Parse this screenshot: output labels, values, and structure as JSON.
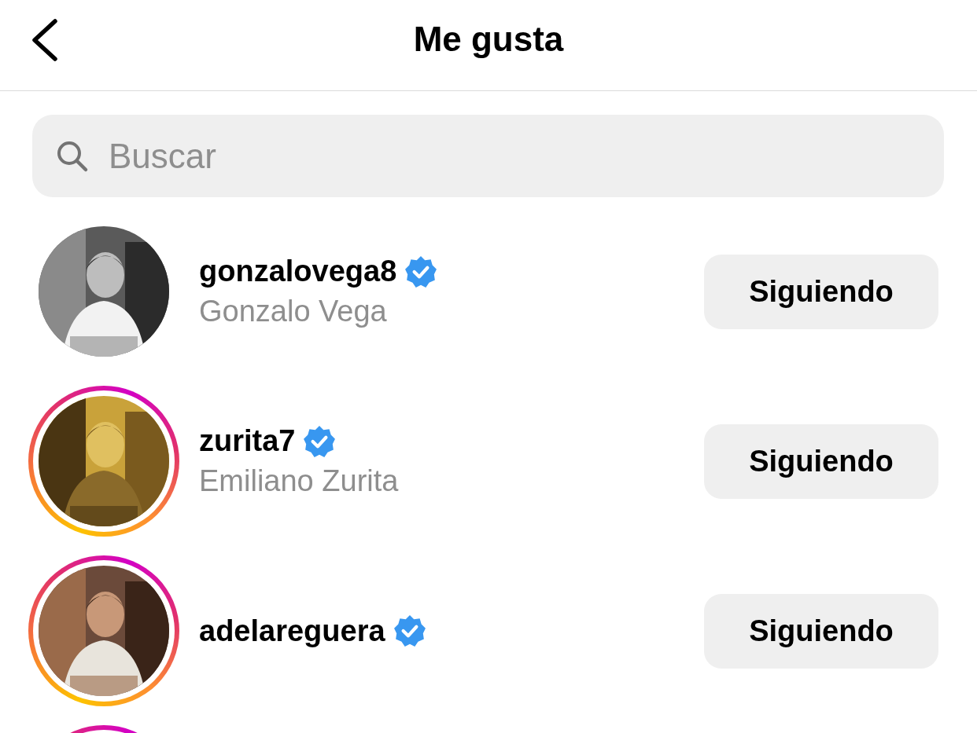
{
  "header": {
    "title": "Me gusta"
  },
  "search": {
    "placeholder": "Buscar"
  },
  "users": [
    {
      "username": "gonzalovega8",
      "verified": true,
      "full_name": "Gonzalo Vega",
      "story_ring": false,
      "button": "Siguiendo"
    },
    {
      "username": "zurita7",
      "verified": true,
      "full_name": "Emiliano Zurita",
      "story_ring": true,
      "button": "Siguiendo"
    },
    {
      "username": "adelareguera",
      "verified": true,
      "story_ring": true,
      "button": "Siguiendo"
    },
    {
      "story_ring": true
    }
  ]
}
